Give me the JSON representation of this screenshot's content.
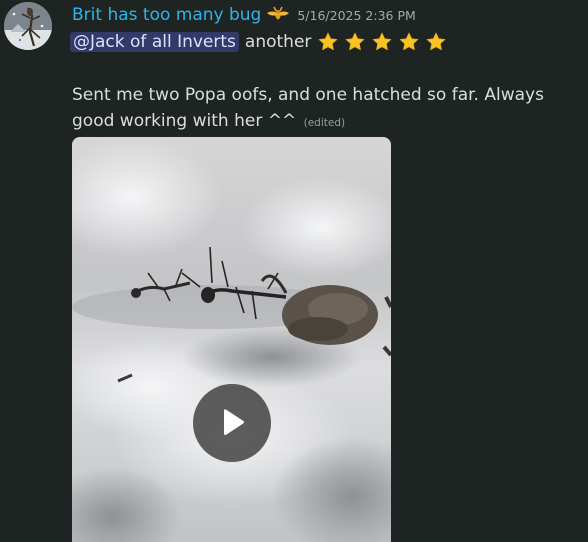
{
  "message": {
    "username": "Brit has too many bug",
    "timestamp": "5/16/2025 2:36 PM",
    "mention": "@Jack of all Inverts",
    "after_mention": "another",
    "stars": [
      "star-icon",
      "star-icon",
      "star-icon",
      "star-icon",
      "star-icon"
    ],
    "body": "Sent me two Popa oofs, and one hatched so far. Always good working with her ^^",
    "edited_label": "(edited)"
  },
  "colors": {
    "background": "#1e2421",
    "username": "#2fb4ea",
    "mention_bg": "#3b4270",
    "star": "#f7c325"
  },
  "attachment": {
    "type": "video",
    "icon": "play-icon"
  }
}
